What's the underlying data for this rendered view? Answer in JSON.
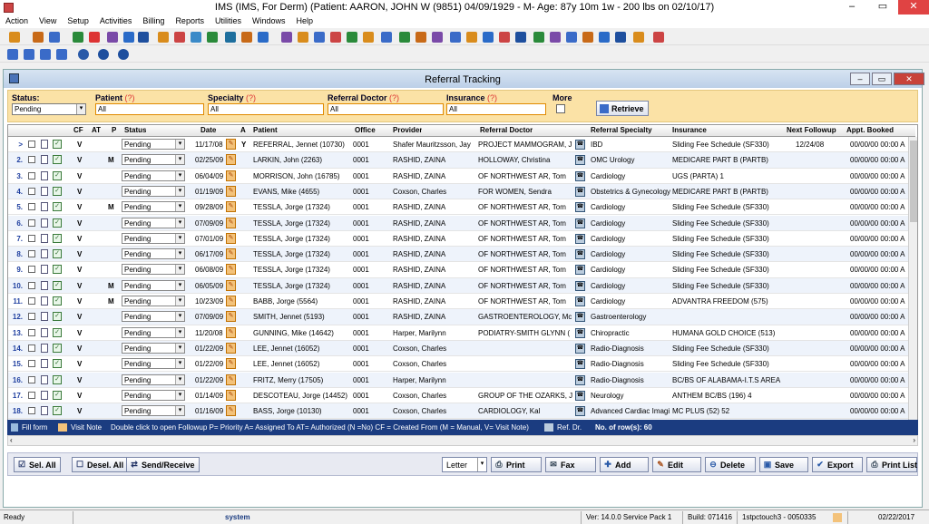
{
  "window": {
    "title": "IMS (IMS, For Derm)    (Patient: AARON, JOHN W (9851) 04/09/1929 - M- Age: 87y 10m 1w - 200 lbs on 02/10/17)",
    "min": "–",
    "max": "▭",
    "close": "✕"
  },
  "menu": [
    "Action",
    "View",
    "Setup",
    "Activities",
    "Billing",
    "Reports",
    "Utilities",
    "Windows",
    "Help"
  ],
  "inner": {
    "title": "Referral Tracking"
  },
  "filters": {
    "status_label": "Status:",
    "status_value": "Pending",
    "patient_label": "Patient",
    "patient_q": "(?)",
    "patient_value": "All",
    "specialty_label": "Specialty",
    "specialty_q": "(?)",
    "specialty_value": "All",
    "refdoc_label": "Referral Doctor",
    "refdoc_q": "(?)",
    "refdoc_value": "All",
    "insurance_label": "Insurance",
    "insurance_q": "(?)",
    "insurance_value": "All",
    "more_label": "More",
    "retrieve_label": "Retrieve"
  },
  "columns": {
    "cf": "CF",
    "at": "AT",
    "p": "P",
    "status": "Status",
    "date": "Date",
    "a": "A",
    "patient": "Patient",
    "office": "Office",
    "provider": "Provider",
    "refdoc": "Referral Doctor",
    "specialty": "Referral Specialty",
    "insurance": "Insurance",
    "followup": "Next Followup",
    "appt": "Appt. Booked"
  },
  "rows": [
    {
      "n": ">",
      "cf": "V",
      "at": "",
      "p": "",
      "status": "Pending",
      "date": "11/17/08",
      "a": "Y",
      "patient": "REFERRAL, Jennet (10730)",
      "office": "0001",
      "provider": "Shafer Mauritzsson, Jay",
      "refdoc": "PROJECT MAMMOGRAM, J",
      "specialty": "IBD",
      "insurance": "Sliding Fee Schedule   (SF330)",
      "followup": "12/24/08",
      "appt": "00/00/00   00:00 A"
    },
    {
      "n": "2.",
      "cf": "V",
      "at": "M",
      "p": "",
      "status": "Pending",
      "date": "02/25/09",
      "a": "",
      "patient": "LARKIN, John (2263)",
      "office": "0001",
      "provider": "RASHID, ZAINA",
      "refdoc": "HOLLOWAY, Christina",
      "specialty": "OMC Urology",
      "insurance": "MEDICARE PART B   (PARTB)",
      "followup": "",
      "appt": "00/00/00   00:00 A"
    },
    {
      "n": "3.",
      "cf": "V",
      "at": "",
      "p": "",
      "status": "Pending",
      "date": "06/04/09",
      "a": "",
      "patient": "MORRISON, John (16785)",
      "office": "0001",
      "provider": "RASHID, ZAINA",
      "refdoc": "OF NORTHWEST AR, Tom",
      "specialty": "Cardiology",
      "insurance": "UGS   (PARTA)    1",
      "followup": "",
      "appt": "00/00/00   00:00 A"
    },
    {
      "n": "4.",
      "cf": "V",
      "at": "",
      "p": "",
      "status": "Pending",
      "date": "01/19/09",
      "a": "",
      "patient": "EVANS, Mike (4655)",
      "office": "0001",
      "provider": "Coxson, Charles",
      "refdoc": "FOR WOMEN, Sendra",
      "specialty": "Obstetrics & Gynecology",
      "insurance": "MEDICARE PART B   (PARTB)",
      "followup": "",
      "appt": "00/00/00   00:00 A"
    },
    {
      "n": "5.",
      "cf": "V",
      "at": "M",
      "p": "",
      "status": "Pending",
      "date": "09/28/09",
      "a": "",
      "patient": "TESSLA, Jorge (17324)",
      "office": "0001",
      "provider": "RASHID, ZAINA",
      "refdoc": "OF NORTHWEST AR, Tom",
      "specialty": "Cardiology",
      "insurance": "Sliding Fee Schedule   (SF330)",
      "followup": "",
      "appt": "00/00/00   00:00 A"
    },
    {
      "n": "6.",
      "cf": "V",
      "at": "",
      "p": "",
      "status": "Pending",
      "date": "07/09/09",
      "a": "",
      "patient": "TESSLA, Jorge (17324)",
      "office": "0001",
      "provider": "RASHID, ZAINA",
      "refdoc": "OF NORTHWEST AR, Tom",
      "specialty": "Cardiology",
      "insurance": "Sliding Fee Schedule   (SF330)",
      "followup": "",
      "appt": "00/00/00   00:00 A"
    },
    {
      "n": "7.",
      "cf": "V",
      "at": "",
      "p": "",
      "status": "Pending",
      "date": "07/01/09",
      "a": "",
      "patient": "TESSLA, Jorge (17324)",
      "office": "0001",
      "provider": "RASHID, ZAINA",
      "refdoc": "OF NORTHWEST AR, Tom",
      "specialty": "Cardiology",
      "insurance": "Sliding Fee Schedule   (SF330)",
      "followup": "",
      "appt": "00/00/00   00:00 A"
    },
    {
      "n": "8.",
      "cf": "V",
      "at": "",
      "p": "",
      "status": "Pending",
      "date": "06/17/09",
      "a": "",
      "patient": "TESSLA, Jorge (17324)",
      "office": "0001",
      "provider": "RASHID, ZAINA",
      "refdoc": "OF NORTHWEST AR, Tom",
      "specialty": "Cardiology",
      "insurance": "Sliding Fee Schedule   (SF330)",
      "followup": "",
      "appt": "00/00/00   00:00 A"
    },
    {
      "n": "9.",
      "cf": "V",
      "at": "",
      "p": "",
      "status": "Pending",
      "date": "06/08/09",
      "a": "",
      "patient": "TESSLA, Jorge (17324)",
      "office": "0001",
      "provider": "RASHID, ZAINA",
      "refdoc": "OF NORTHWEST AR, Tom",
      "specialty": "Cardiology",
      "insurance": "Sliding Fee Schedule   (SF330)",
      "followup": "",
      "appt": "00/00/00   00:00 A"
    },
    {
      "n": "10.",
      "cf": "V",
      "at": "M",
      "p": "",
      "status": "Pending",
      "date": "06/05/09",
      "a": "",
      "patient": "TESSLA, Jorge (17324)",
      "office": "0001",
      "provider": "RASHID, ZAINA",
      "refdoc": "OF NORTHWEST AR, Tom",
      "specialty": "Cardiology",
      "insurance": "Sliding Fee Schedule   (SF330)",
      "followup": "",
      "appt": "00/00/00   00:00 A"
    },
    {
      "n": "11.",
      "cf": "V",
      "at": "M",
      "p": "",
      "status": "Pending",
      "date": "10/23/09",
      "a": "",
      "patient": "BABB, Jorge (5564)",
      "office": "0001",
      "provider": "RASHID, ZAINA",
      "refdoc": "OF NORTHWEST AR, Tom",
      "specialty": "Cardiology",
      "insurance": "ADVANTRA FREEDOM   (575)",
      "followup": "",
      "appt": "00/00/00   00:00 A"
    },
    {
      "n": "12.",
      "cf": "V",
      "at": "",
      "p": "",
      "status": "Pending",
      "date": "07/09/09",
      "a": "",
      "patient": "SMITH, Jennet (5193)",
      "office": "0001",
      "provider": "RASHID, ZAINA",
      "refdoc": "GASTROENTEROLOGY, Mc",
      "specialty": "Gastroenterology",
      "insurance": "",
      "followup": "",
      "appt": "00/00/00   00:00 A"
    },
    {
      "n": "13.",
      "cf": "V",
      "at": "",
      "p": "",
      "status": "Pending",
      "date": "11/20/08",
      "a": "",
      "patient": "GUNNING, Mike (14642)",
      "office": "0001",
      "provider": "Harper, Marilynn",
      "refdoc": "PODIATRY-SMITH GLYNN (",
      "specialty": "Chiropractic",
      "insurance": "HUMANA GOLD CHOICE   (513)",
      "followup": "",
      "appt": "00/00/00   00:00 A"
    },
    {
      "n": "14.",
      "cf": "V",
      "at": "",
      "p": "",
      "status": "Pending",
      "date": "01/22/09",
      "a": "",
      "patient": "LEE, Jennet (16052)",
      "office": "0001",
      "provider": "Coxson, Charles",
      "refdoc": "",
      "specialty": "Radio-Diagnosis",
      "insurance": "Sliding Fee Schedule   (SF330)",
      "followup": "",
      "appt": "00/00/00   00:00 A"
    },
    {
      "n": "15.",
      "cf": "V",
      "at": "",
      "p": "",
      "status": "Pending",
      "date": "01/22/09",
      "a": "",
      "patient": "LEE, Jennet (16052)",
      "office": "0001",
      "provider": "Coxson, Charles",
      "refdoc": "",
      "specialty": "Radio-Diagnosis",
      "insurance": "Sliding Fee Schedule   (SF330)",
      "followup": "",
      "appt": "00/00/00   00:00 A"
    },
    {
      "n": "16.",
      "cf": "V",
      "at": "",
      "p": "",
      "status": "Pending",
      "date": "01/22/09",
      "a": "",
      "patient": "FRITZ, Merry (17505)",
      "office": "0001",
      "provider": "Harper, Marilynn",
      "refdoc": "",
      "specialty": "Radio-Diagnosis",
      "insurance": "BC/BS OF ALABAMA-I.T.S AREA",
      "followup": "",
      "appt": "00/00/00   00:00 A"
    },
    {
      "n": "17.",
      "cf": "V",
      "at": "",
      "p": "",
      "status": "Pending",
      "date": "01/14/09",
      "a": "",
      "patient": "DESCOTEAU, Jorge (14452)",
      "office": "0001",
      "provider": "Coxson, Charles",
      "refdoc": "GROUP OF THE OZARKS, J",
      "specialty": "Neurology",
      "insurance": "ANTHEM BC/BS   (196)    4",
      "followup": "",
      "appt": "00/00/00   00:00 A"
    },
    {
      "n": "18.",
      "cf": "V",
      "at": "",
      "p": "",
      "status": "Pending",
      "date": "01/16/09",
      "a": "",
      "patient": "BASS, Jorge (10130)",
      "office": "0001",
      "provider": "Coxson, Charles",
      "refdoc": "CARDIOLOGY, Kal",
      "specialty": "Advanced Cardiac Imagi",
      "insurance": "MC PLUS   (52)    52",
      "followup": "",
      "appt": "00/00/00   00:00 A"
    }
  ],
  "legend": {
    "fill_form": "Fill form",
    "visit_note": "Visit Note",
    "text": "Double click to open Followup  P= Priority   A= Assigned To  AT= Authorized (N =No)  CF = Created From (M = Manual, V= Visit Note)",
    "ref_dr": "Ref. Dr.",
    "rows": "No. of row(s): 60"
  },
  "buttons": {
    "sel_all": "Sel. All",
    "desel_all": "Desel. All",
    "send_receive": "Send/Receive",
    "paper": "Letter",
    "print": "Print",
    "fax": "Fax",
    "add": "Add",
    "edit": "Edit",
    "delete": "Delete",
    "save": "Save",
    "export": "Export",
    "print_list": "Print List"
  },
  "status": {
    "ready": "Ready",
    "user": "system",
    "version": "Ver: 14.0.0 Service Pack 1",
    "build": "Build: 071416",
    "host": "1stpctouch3 - 0050335",
    "date": "02/22/2017"
  },
  "colors": {
    "filter_bg": "#fbe2a6",
    "legend_bg": "#1b3c80",
    "row_number": "#2040a0"
  }
}
